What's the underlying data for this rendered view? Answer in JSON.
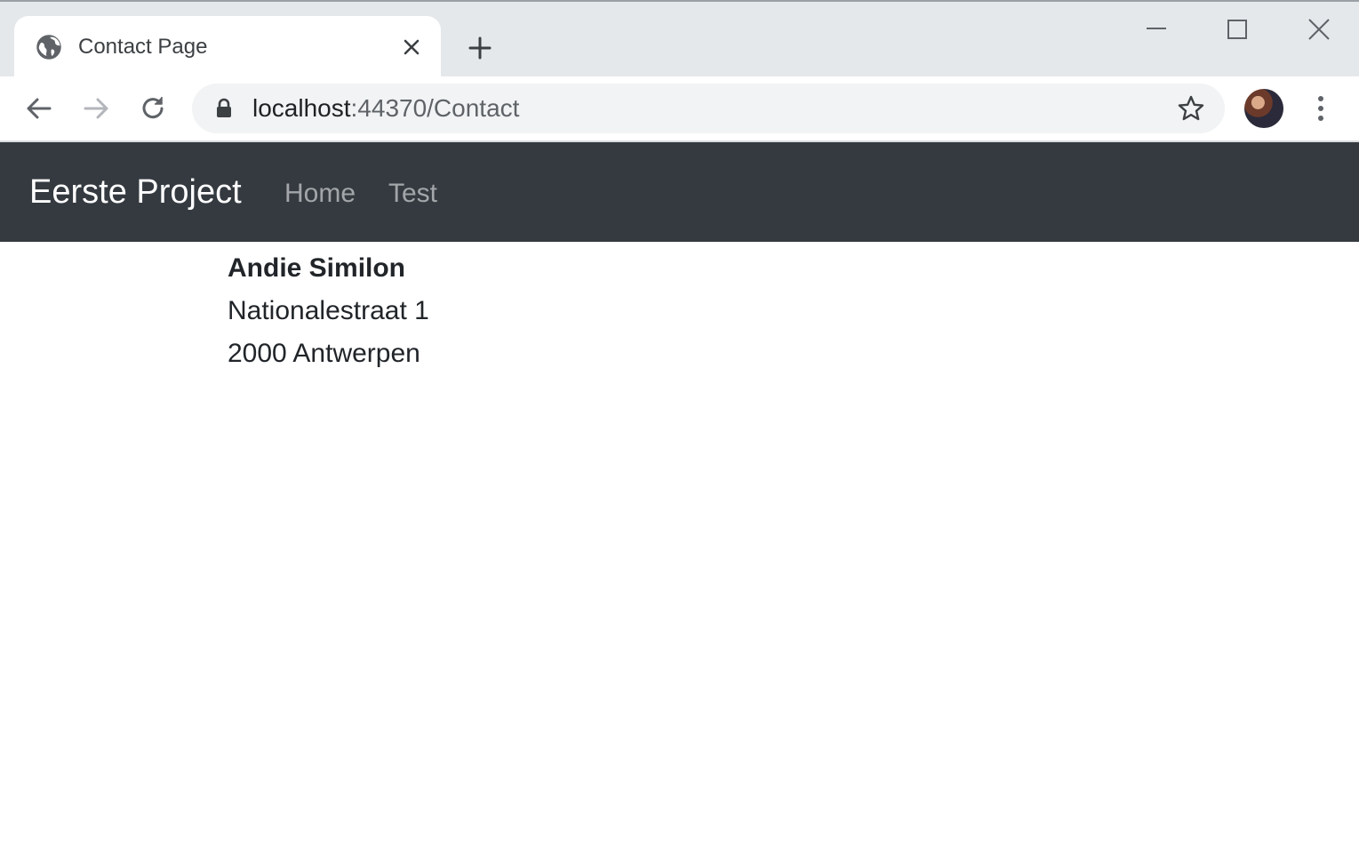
{
  "browser": {
    "tab_title": "Contact Page",
    "url_host": "localhost",
    "url_path": ":44370/Contact",
    "icons": [
      "globe-icon",
      "close-icon",
      "plus-icon",
      "minimize-icon",
      "maximize-icon",
      "window-close-icon",
      "back-arrow-icon",
      "forward-arrow-icon",
      "reload-icon",
      "lock-icon",
      "star-icon",
      "kebab-menu-icon"
    ]
  },
  "navbar": {
    "brand": "Eerste Project",
    "links": [
      "Home",
      "Test"
    ],
    "background": "#343a40"
  },
  "contact": {
    "name": "Andie Similon",
    "street": "Nationalestraat 1",
    "city": "2000 Antwerpen"
  }
}
